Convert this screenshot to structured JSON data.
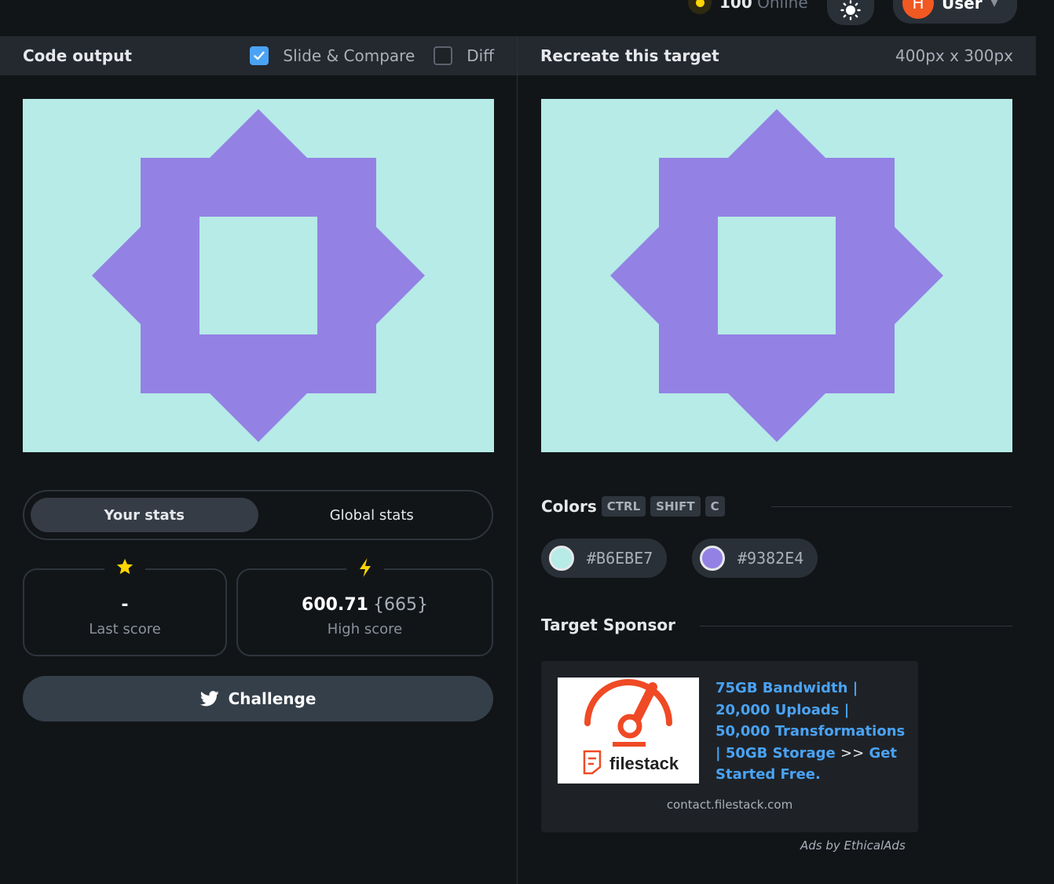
{
  "topbar": {
    "online_count": "100",
    "online_label": "Online",
    "user_initial": "H",
    "user_name": "User"
  },
  "left_panel": {
    "title": "Code output",
    "slide_compare_label": "Slide & Compare",
    "slide_compare_checked": true,
    "diff_label": "Diff",
    "diff_checked": false
  },
  "right_panel": {
    "title": "Recreate this target",
    "dimensions": "400px x 300px"
  },
  "stats": {
    "tabs": [
      {
        "label": "Your stats",
        "active": true
      },
      {
        "label": "Global stats",
        "active": false
      }
    ],
    "last_score_value": "-",
    "last_score_label": "Last score",
    "high_score_value": "600.71",
    "high_score_extra": "{665}",
    "high_score_label": "High score"
  },
  "challenge_label": "Challenge",
  "colors_section": {
    "title": "Colors",
    "shortcut_keys": [
      "CTRL",
      "SHIFT",
      "C"
    ],
    "swatches": [
      {
        "hex": "#B6EBE7",
        "label": "#B6EBE7"
      },
      {
        "hex": "#9382E4",
        "label": "#9382E4"
      }
    ]
  },
  "sponsor": {
    "title": "Target Sponsor",
    "ad_logo_text": "filestack",
    "ad_text_link_1": "75GB Bandwidth | 20,000 Uploads | 50,000 Transformations | 50GB Storage",
    "ad_text_separator": ">>",
    "ad_text_link_2": "Get Started Free.",
    "ad_domain": "contact.filestack.com",
    "ads_by": "Ads by EthicalAds"
  },
  "palette": {
    "background": "#121518",
    "panel_header": "#24282f",
    "accent_blue": "#4aa3f5",
    "target_bg": "#B6EBE7",
    "target_fg": "#9382E4",
    "brand_orange": "#f25822"
  }
}
